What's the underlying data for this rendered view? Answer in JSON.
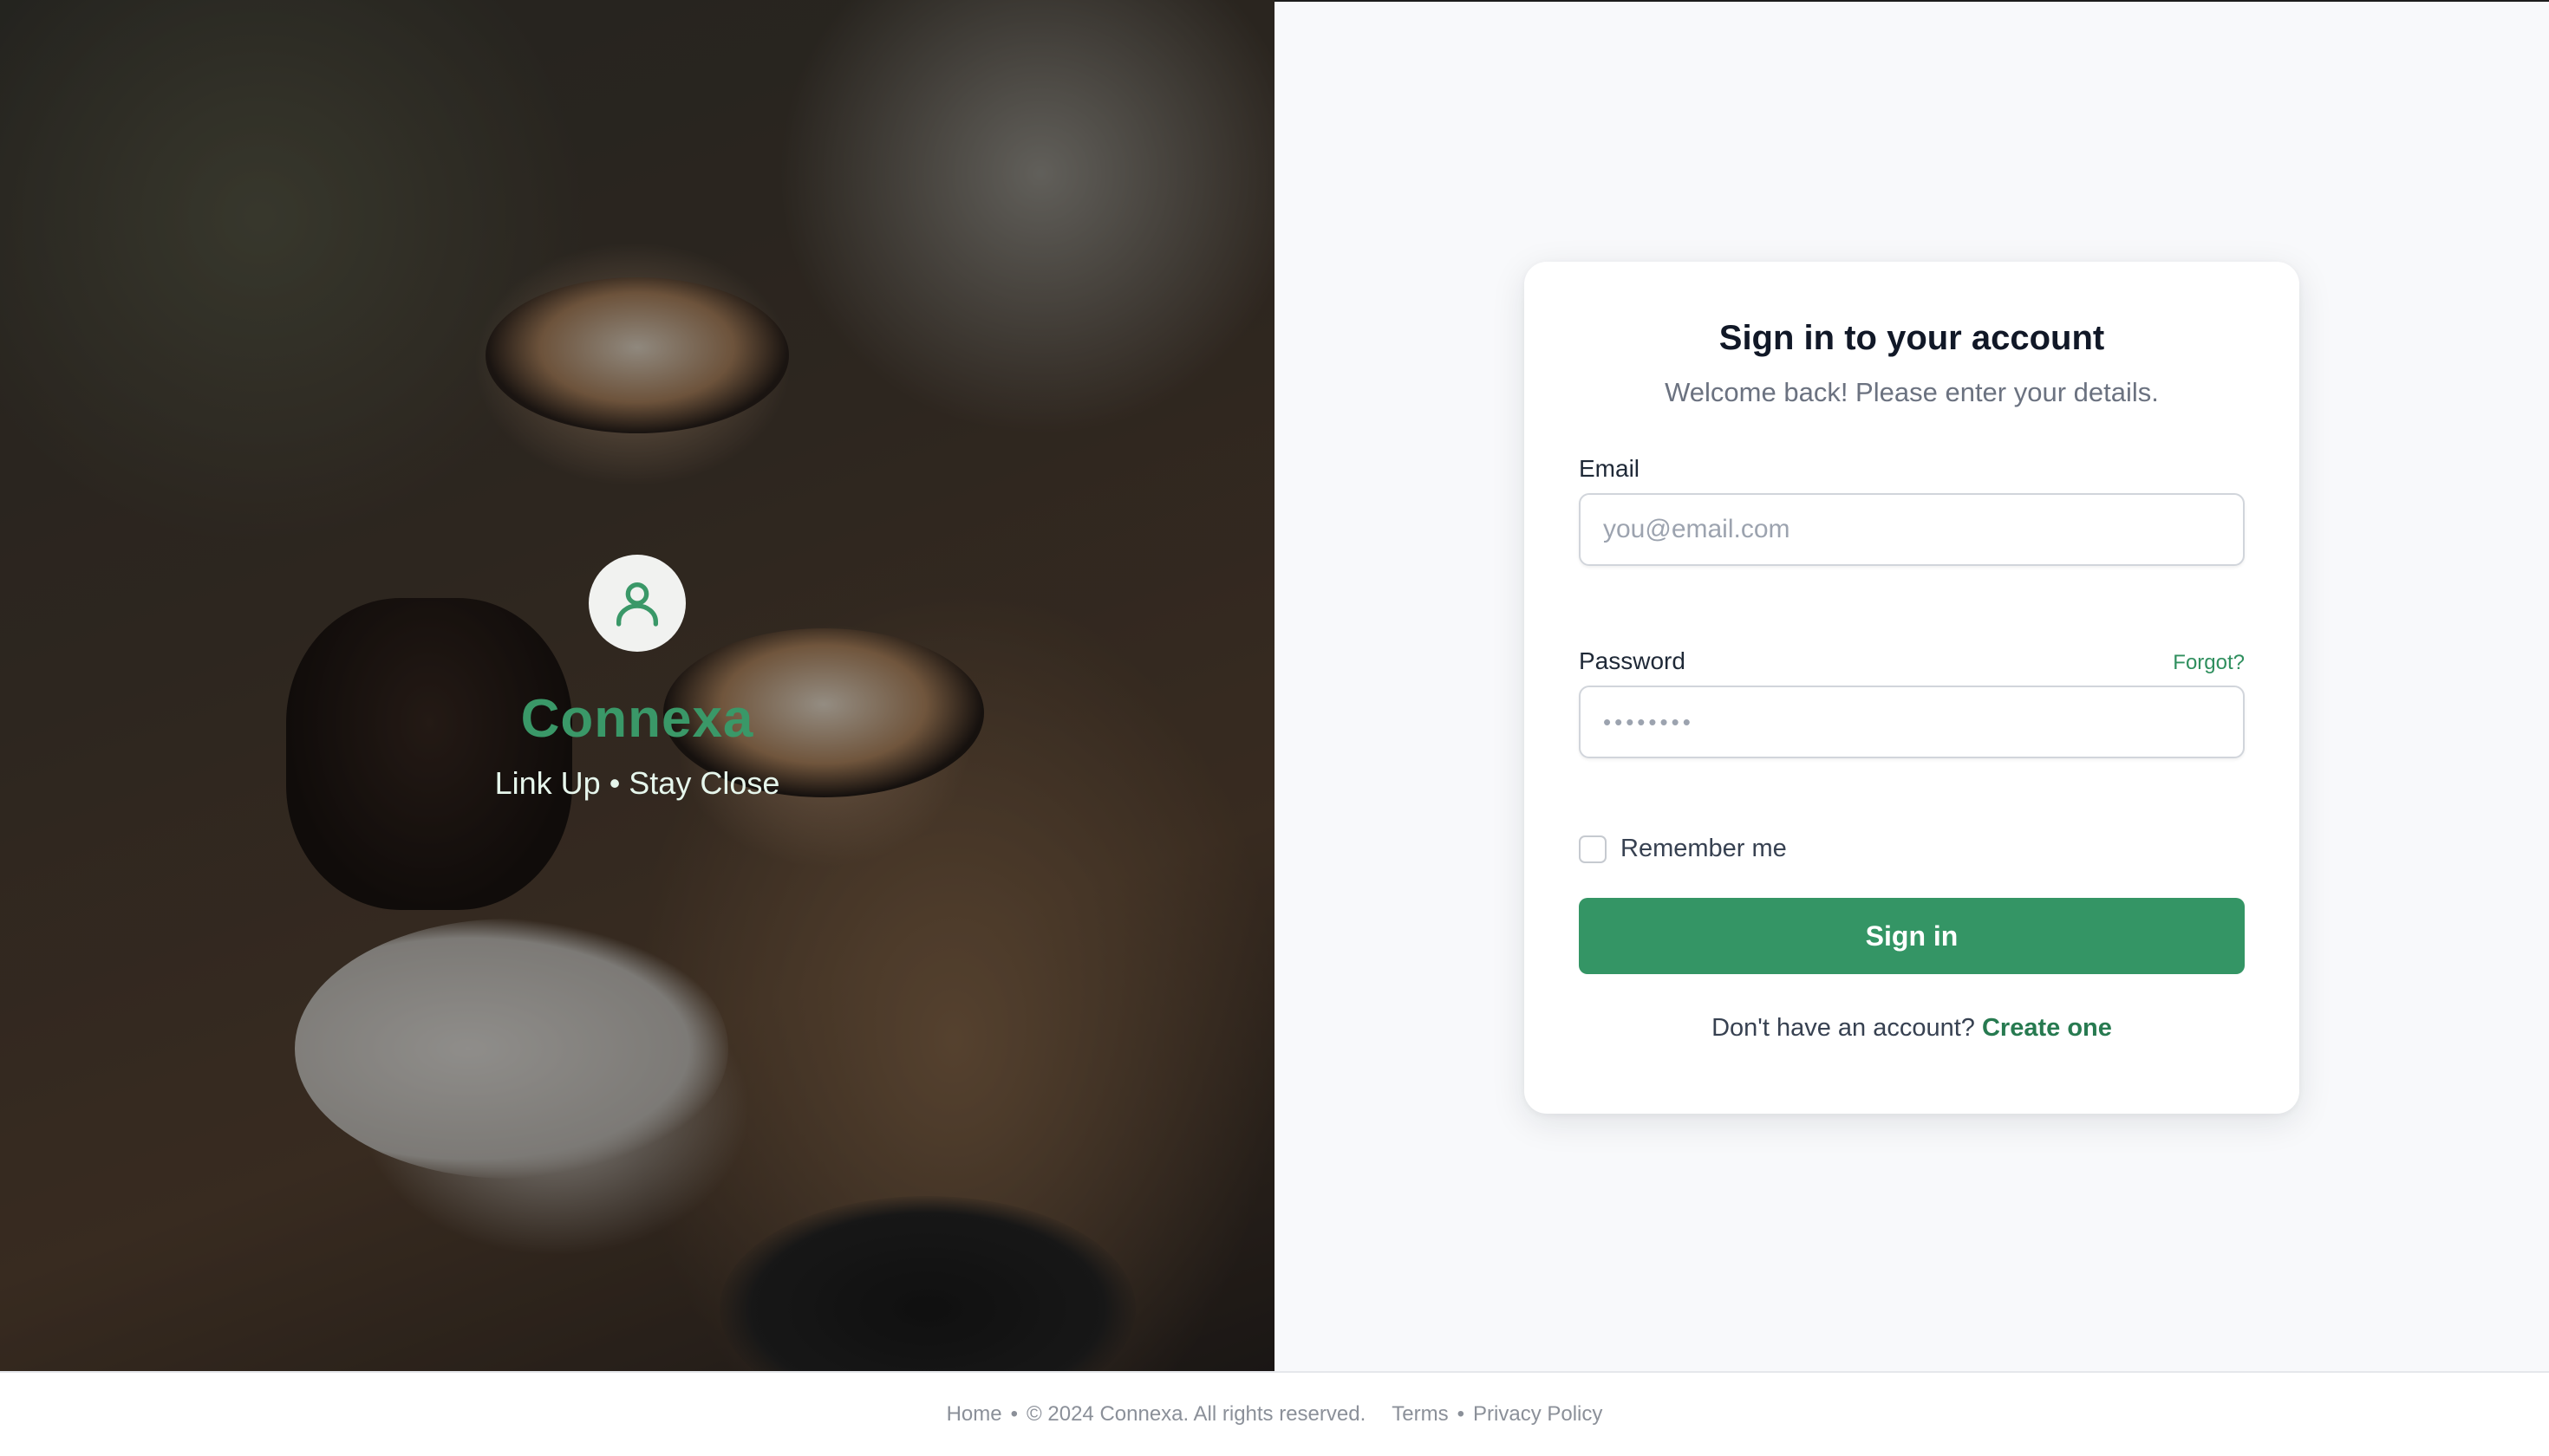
{
  "brand": {
    "name": "Connexa",
    "tagline": "Link Up • Stay Close",
    "accent_color": "#349565",
    "avatar_icon": "user-icon"
  },
  "login": {
    "title": "Sign in to your account",
    "subtitle": "Welcome back! Please enter your details.",
    "email_label": "Email",
    "email_placeholder": "you@email.com",
    "password_label": "Password",
    "password_placeholder": "••••••••",
    "forgot_label": "Forgot?",
    "remember_label": "Remember me",
    "remember_checked": false,
    "signin_label": "Sign in",
    "signup_prompt": "Don't have an account?",
    "signup_link": "Create one"
  },
  "footer": {
    "home": "Home",
    "separator": "•",
    "copyright": "© 2024 Connexa. All rights reserved.",
    "terms": "Terms",
    "privacy": "Privacy Policy"
  }
}
